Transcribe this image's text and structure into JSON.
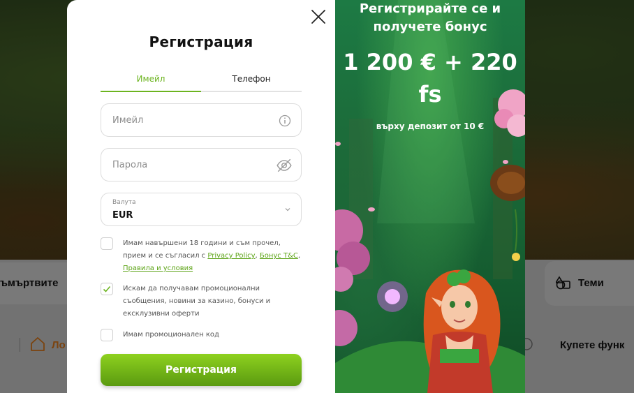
{
  "background": {
    "card_texts": [
      "ъмъртвите",
      "Теми",
      "Ло",
      "Купете функ"
    ]
  },
  "modal": {
    "title": "Регистрация",
    "tabs": [
      {
        "label": "Имейл",
        "active": true
      },
      {
        "label": "Телефон",
        "active": false
      }
    ],
    "email": {
      "placeholder": "Имейл",
      "icon": "info-icon"
    },
    "password": {
      "placeholder": "Парола",
      "icon": "eye-off-icon"
    },
    "currency": {
      "label": "Валута",
      "value": "EUR",
      "icon": "chevron-down-icon"
    },
    "checkboxes": {
      "age": {
        "text_before": "Имам навършени 18 години и съм прочел, прием и се съгласил с ",
        "link_privacy": "Privacy Policy",
        "sep1": ", ",
        "link_bonus": "Бонус T&C",
        "sep2": ",",
        "link_terms": "Правила и условия",
        "checked": false
      },
      "promo": {
        "text": "Искам да получавам промоционални съобщения, новини за казино, бонуси и ексклузивни оферти",
        "checked": true
      },
      "code": {
        "text": "Имам промоционален код",
        "checked": false
      }
    },
    "submit_label": "Регистрация"
  },
  "promo": {
    "headline_line1": "Регистрирайте се и",
    "headline_line2": "получете бонус",
    "amount_line1": "1 200 € + 220",
    "amount_line2": "fs",
    "subtext": "върху депозит от 10 €"
  },
  "colors": {
    "accent_green": "#6cb41f",
    "button_top": "#8ed11f",
    "button_bottom": "#5a9a10",
    "promo_bg": "#1b6c3a"
  }
}
